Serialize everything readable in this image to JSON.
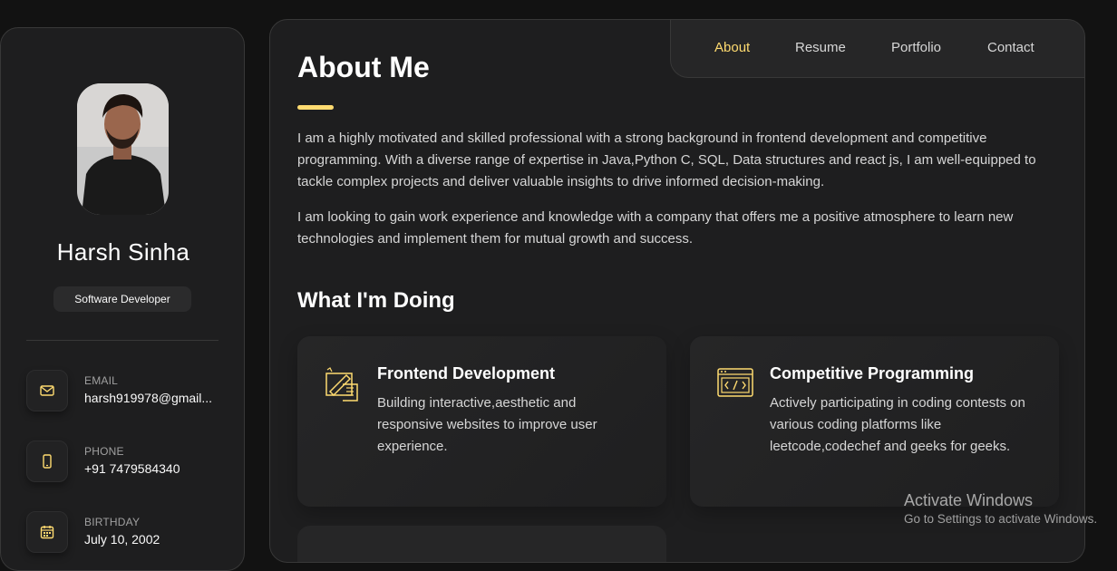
{
  "sidebar": {
    "name": "Harsh Sinha",
    "role": "Software Developer",
    "contacts": [
      {
        "label": "Email",
        "value": "harsh919978@gmail...",
        "icon": "mail-icon"
      },
      {
        "label": "Phone",
        "value": "+91 7479584340",
        "icon": "phone-icon"
      },
      {
        "label": "Birthday",
        "value": "July 10, 2002",
        "icon": "calendar-icon"
      }
    ]
  },
  "navbar": {
    "items": [
      "About",
      "Resume",
      "Portfolio",
      "Contact"
    ],
    "active": "About"
  },
  "about": {
    "title": "About Me",
    "paragraphs": [
      "I am a highly motivated and skilled professional with a strong background in frontend development and competitive programming. With a diverse range of expertise in Java,Python C, SQL, Data structures and react js, I am well-equipped to tackle complex projects and deliver valuable insights to drive informed decision-making.",
      "I am looking to gain work experience and knowledge with a company that offers me a positive atmosphere to learn new technologies and implement them for mutual growth and success."
    ]
  },
  "services": {
    "title": "What I'm Doing",
    "items": [
      {
        "title": "Frontend Development",
        "text": "Building interactive,aesthetic and responsive websites to improve user experience.",
        "icon": "design-tools-icon"
      },
      {
        "title": "Competitive Programming",
        "text": "Actively participating in coding contests on various coding platforms like leetcode,codechef and geeks for geeks.",
        "icon": "code-window-icon"
      }
    ]
  },
  "watermark": {
    "title": "Activate Windows",
    "subtitle": "Go to Settings to activate Windows."
  },
  "colors": {
    "accent": "#ffdb70",
    "background": "#121212",
    "panel": "#1e1e1f"
  }
}
